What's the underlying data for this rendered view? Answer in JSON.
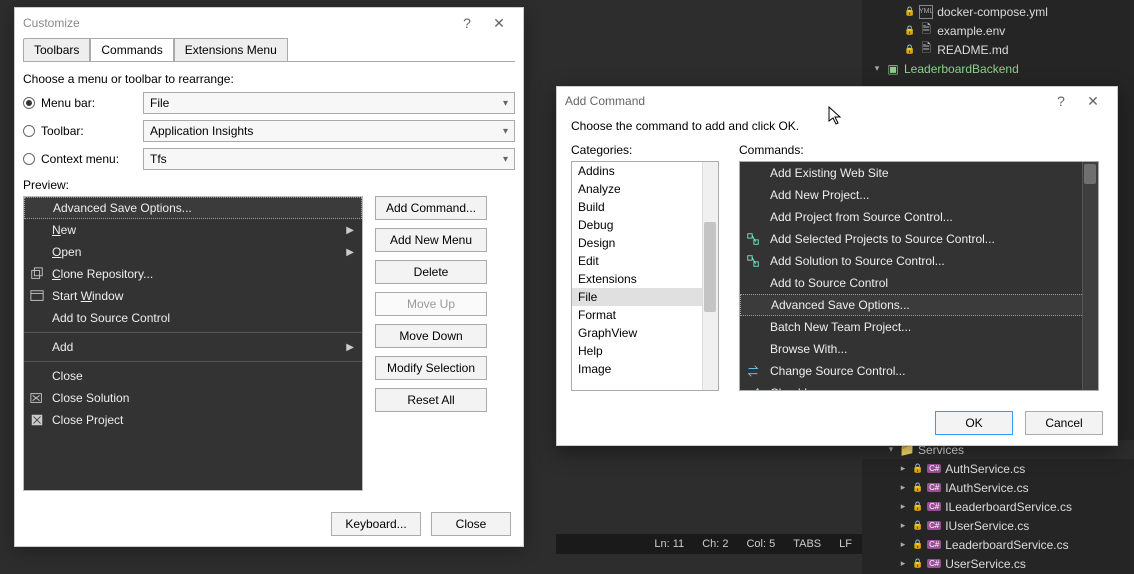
{
  "customize": {
    "title": "Customize",
    "help": "?",
    "tabs": [
      "Toolbars",
      "Commands",
      "Extensions Menu"
    ],
    "active_tab": 1,
    "choose_label": "Choose a menu or toolbar to rearrange:",
    "radios": {
      "menubar": "Menu bar:",
      "toolbar": "Toolbar:",
      "contextmenu": "Context menu:"
    },
    "menubar_value": "File",
    "toolbar_value": "Application Insights",
    "contextmenu_value": "Tfs",
    "preview_label": "Preview:",
    "preview_items": [
      {
        "label": "Advanced Save Options...",
        "selected": true
      },
      {
        "label": "New",
        "u": "N",
        "submenu": true
      },
      {
        "label": "Open",
        "u": "O",
        "submenu": true
      },
      {
        "label": "Clone Repository...",
        "u": "C",
        "icon": "clone"
      },
      {
        "label": "Start Window",
        "u": "W",
        "icon": "window"
      },
      {
        "label": "Add to Source Control"
      },
      {
        "sep": true
      },
      {
        "label": "Add",
        "submenu": true
      },
      {
        "sep": true
      },
      {
        "label": "Close"
      },
      {
        "label": "Close Solution",
        "icon": "closesln"
      },
      {
        "label": "Close Project",
        "icon": "closeproj"
      }
    ],
    "buttons": {
      "add_command": "Add Command...",
      "add_menu": "Add New Menu",
      "delete": "Delete",
      "move_up": "Move Up",
      "move_down": "Move Down",
      "modify": "Modify Selection",
      "reset": "Reset All"
    },
    "footer": {
      "keyboard": "Keyboard...",
      "close": "Close"
    }
  },
  "addcmd": {
    "title": "Add Command",
    "help": "?",
    "hint": "Choose the command to add and click OK.",
    "categories_label": "Categories:",
    "commands_label": "Commands:",
    "categories": [
      "Addins",
      "Analyze",
      "Build",
      "Debug",
      "Design",
      "Edit",
      "Extensions",
      "File",
      "Format",
      "GraphView",
      "Help",
      "Image"
    ],
    "selected_category": "File",
    "commands": [
      {
        "label": "Add Existing Web Site"
      },
      {
        "label": "Add New Project..."
      },
      {
        "label": "Add Project from Source Control..."
      },
      {
        "label": "Add Selected Projects to Source Control...",
        "icon": "srcctrl"
      },
      {
        "label": "Add Solution to Source Control...",
        "icon": "srcctrl"
      },
      {
        "label": "Add to Source Control"
      },
      {
        "label": "Advanced Save Options...",
        "selected": true
      },
      {
        "label": "Batch New Team Project..."
      },
      {
        "label": "Browse With..."
      },
      {
        "label": "Change Source Control...",
        "icon": "change"
      },
      {
        "label": "CheckIn",
        "icon": "checkin"
      }
    ],
    "ok": "OK",
    "cancel": "Cancel"
  },
  "sol": {
    "items": [
      {
        "indent": 28,
        "lock": true,
        "icon": "yml",
        "label": "docker-compose.yml"
      },
      {
        "indent": 28,
        "lock": true,
        "icon": "doc",
        "label": "example.env"
      },
      {
        "indent": 28,
        "lock": true,
        "icon": "doc",
        "label": "README.md"
      },
      {
        "indent": 10,
        "caret": "▾",
        "icon": "proj",
        "label": "LeaderboardBackend",
        "color": "#8bd18b"
      },
      {
        "indent": 24,
        "caret": "▾",
        "icon": "folder",
        "label": "Services",
        "selected": true
      },
      {
        "indent": 36,
        "caret": "▸",
        "lock": true,
        "icon": "cs",
        "label": "AuthService.cs"
      },
      {
        "indent": 36,
        "caret": "▸",
        "lock": true,
        "icon": "cs",
        "label": "IAuthService.cs"
      },
      {
        "indent": 36,
        "caret": "▸",
        "lock": true,
        "icon": "cs",
        "label": "ILeaderboardService.cs"
      },
      {
        "indent": 36,
        "caret": "▸",
        "lock": true,
        "icon": "cs",
        "label": "IUserService.cs"
      },
      {
        "indent": 36,
        "caret": "▸",
        "lock": true,
        "icon": "cs",
        "label": "LeaderboardService.cs"
      },
      {
        "indent": 36,
        "caret": "▸",
        "lock": true,
        "icon": "cs",
        "label": "UserService.cs"
      }
    ]
  },
  "status": {
    "ln": "Ln: 11",
    "ch": "Ch: 2",
    "col": "Col: 5",
    "tabs": "TABS",
    "lf": "LF"
  }
}
